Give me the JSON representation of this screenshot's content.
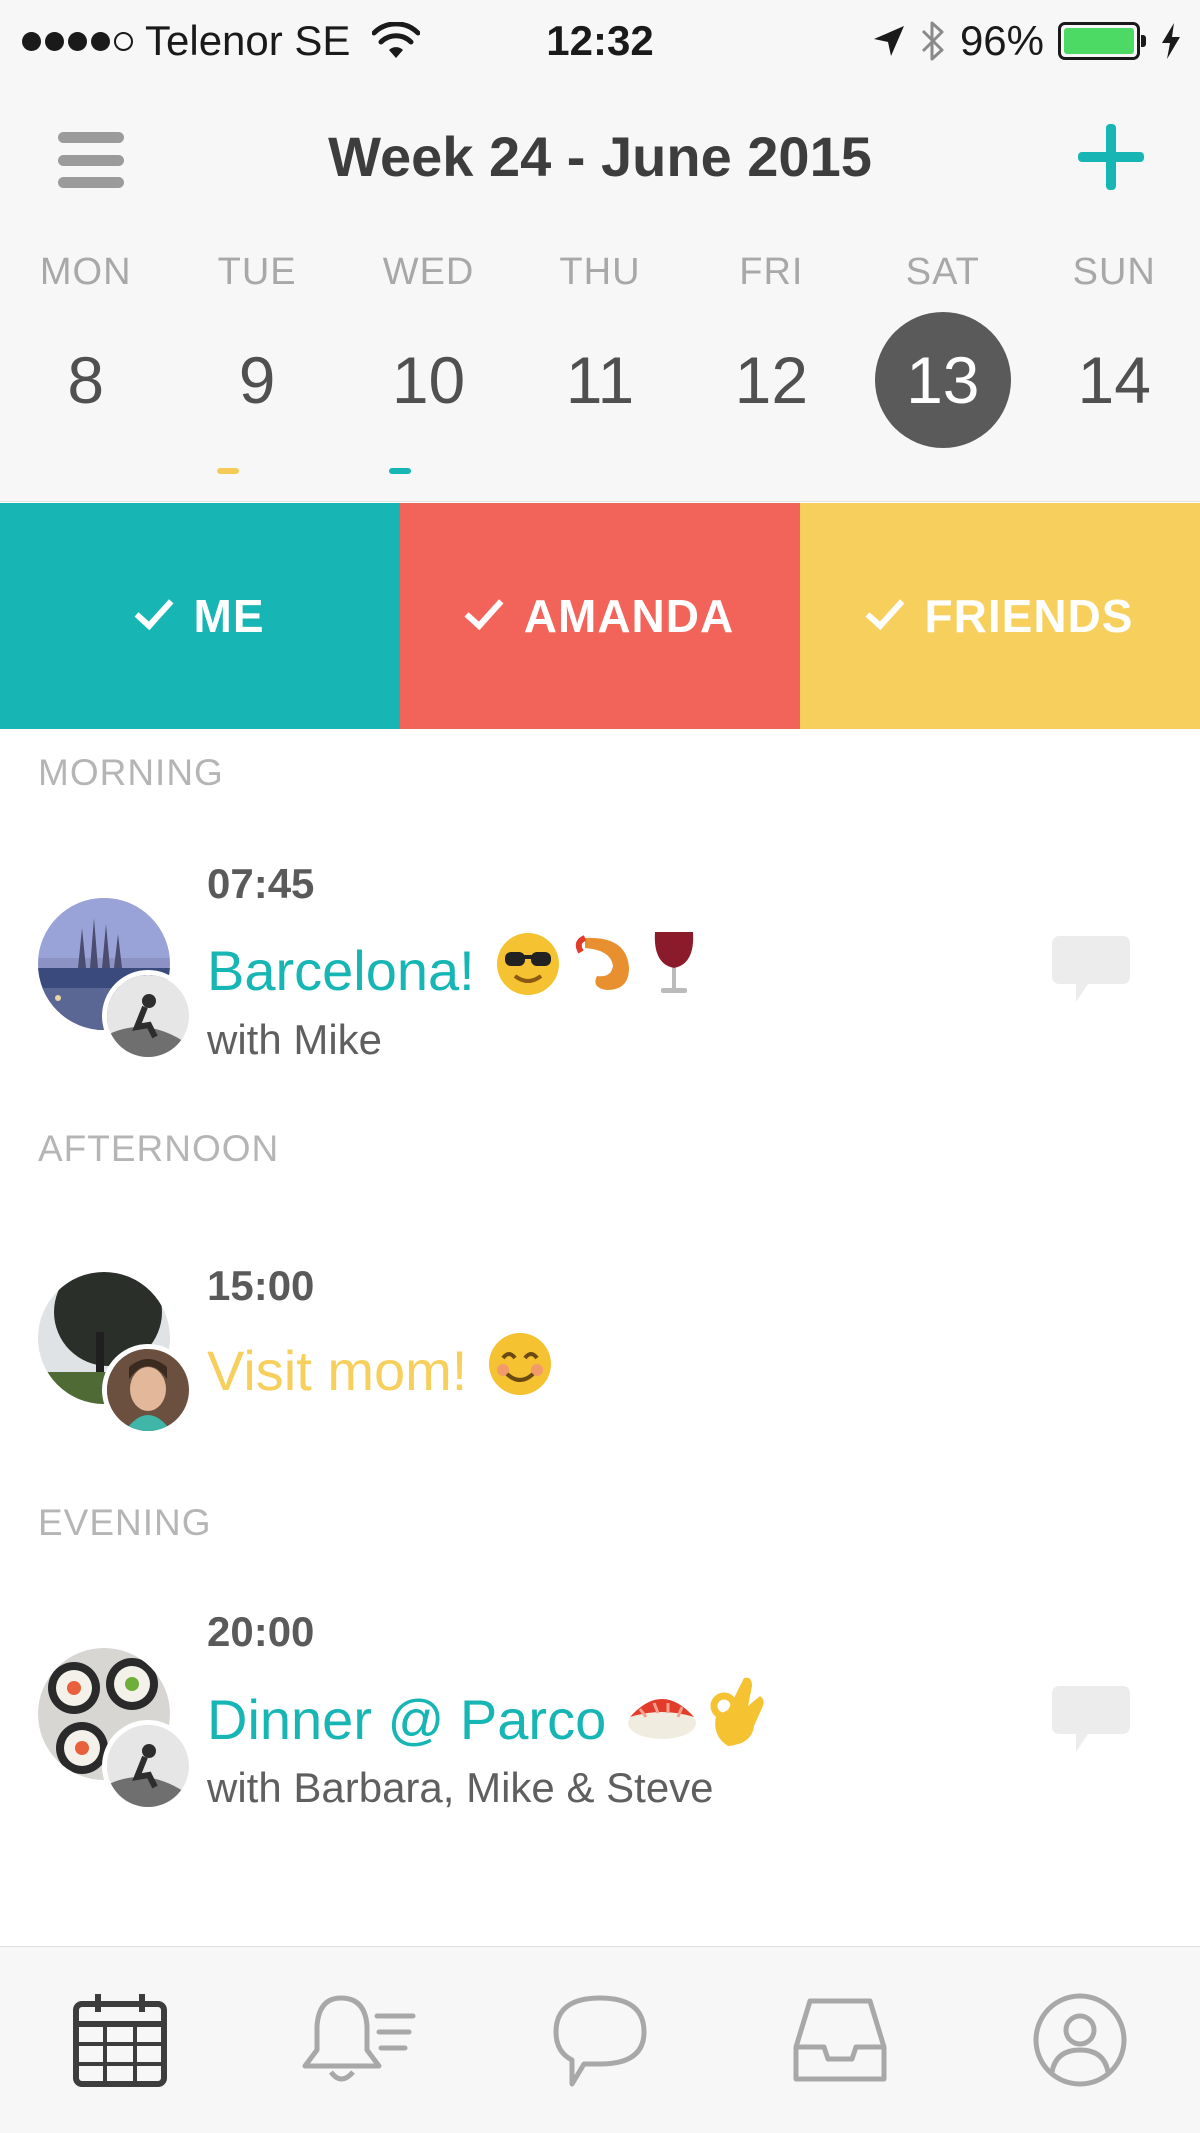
{
  "status_bar": {
    "carrier": "Telenor SE",
    "time": "12:32",
    "battery_percent": "96%",
    "signal_bars_filled": 4,
    "signal_bars_total": 5,
    "battery_color": "#4cd964"
  },
  "header": {
    "title": "Week 24 - June 2015",
    "menu_icon": "hamburger-menu-icon",
    "add_icon": "plus-icon",
    "accent_color": "#17b5b4"
  },
  "week": {
    "days": [
      {
        "name": "MON",
        "number": "8",
        "selected": false,
        "marker": null
      },
      {
        "name": "TUE",
        "number": "9",
        "selected": false,
        "marker": "#f5cc57"
      },
      {
        "name": "WED",
        "number": "10",
        "selected": false,
        "marker": "#17b5b4"
      },
      {
        "name": "THU",
        "number": "11",
        "selected": false,
        "marker": null
      },
      {
        "name": "FRI",
        "number": "12",
        "selected": false,
        "marker": null
      },
      {
        "name": "SAT",
        "number": "13",
        "selected": true,
        "marker": null
      },
      {
        "name": "SUN",
        "number": "14",
        "selected": false,
        "marker": null
      }
    ]
  },
  "filters": [
    {
      "label": "ME",
      "color": "#17b5b4",
      "checked": true
    },
    {
      "label": "AMANDA",
      "color": "#f2645a",
      "checked": true
    },
    {
      "label": "FRIENDS",
      "color": "#f6cf5c",
      "checked": true
    }
  ],
  "sections": {
    "morning": "MORNING",
    "afternoon": "AFTERNOON",
    "evening": "EVENING"
  },
  "events": [
    {
      "time": "07:45",
      "title": "Barcelona!",
      "emojis": [
        "sunglasses-emoji",
        "shrimp-emoji",
        "wine-glass-emoji"
      ],
      "with": "with Mike",
      "title_color": "#17b5b4",
      "has_comments": true
    },
    {
      "time": "15:00",
      "title": "Visit mom!",
      "emojis": [
        "smiling-face-emoji"
      ],
      "with": "",
      "title_color": "#f6cf5c",
      "has_comments": false
    },
    {
      "time": "20:00",
      "title": "Dinner @ Parco",
      "emojis": [
        "sushi-emoji",
        "ok-hand-emoji"
      ],
      "with": "with Barbara, Mike & Steve",
      "title_color": "#17b5b4",
      "has_comments": true
    }
  ],
  "tabbar": {
    "tabs": [
      {
        "icon": "calendar-icon",
        "active": true
      },
      {
        "icon": "notifications-bell-icon",
        "active": false
      },
      {
        "icon": "chat-bubble-icon",
        "active": false
      },
      {
        "icon": "inbox-tray-icon",
        "active": false
      },
      {
        "icon": "profile-icon",
        "active": false
      }
    ]
  }
}
